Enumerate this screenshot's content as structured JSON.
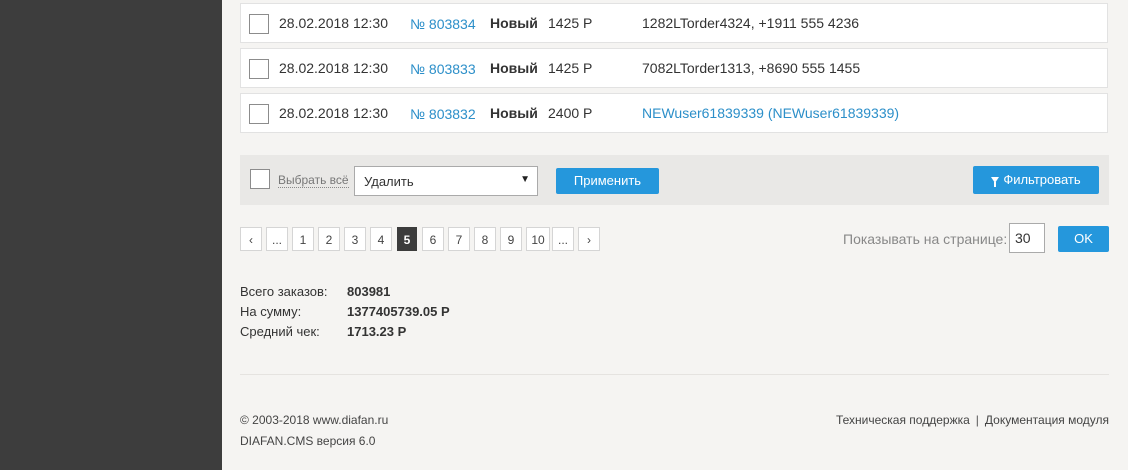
{
  "orders": [
    {
      "date": "28.02.2018 12:30",
      "number": "№ 803834",
      "status": "Новый",
      "amount": "1425 Р",
      "customer": "1282LTorder4324, +1911 555 4236"
    },
    {
      "date": "28.02.2018 12:30",
      "number": "№ 803833",
      "status": "Новый",
      "amount": "1425 Р",
      "customer": "7082LTorder1313, +8690 555 1455"
    },
    {
      "date": "28.02.2018 12:30",
      "number": "№ 803832",
      "status": "Новый",
      "amount": "2400 Р",
      "customer": "NEWuser61839339 (NEWuser61839339)"
    }
  ],
  "actions": {
    "select_all_label": "Выбрать всё",
    "selected_action": "Удалить",
    "select_arrow": "▼",
    "apply_label": "Применить",
    "filter_label": "Фильтровать"
  },
  "pagination": {
    "prev": "‹",
    "ellipsis_left": "...",
    "pages": [
      "1",
      "2",
      "3",
      "4",
      "5",
      "6",
      "7",
      "8",
      "9",
      "10"
    ],
    "current": "5",
    "ellipsis_right": "...",
    "next": "›",
    "per_page_label": "Показывать на странице:",
    "per_page_value": "30",
    "ok_label": "OK"
  },
  "totals": {
    "total_orders_label": "Всего заказов:",
    "total_orders_value": "803981",
    "sum_label": "На сумму:",
    "sum_value": "1377405739.05 Р",
    "average_label": "Средний чек:",
    "average_value": "1713.23 Р"
  },
  "footer": {
    "copyright": "© 2003-2018 www.diafan.ru",
    "version": "DIAFAN.CMS версия 6.0",
    "support_link": "Техническая поддержка",
    "separator": "|",
    "docs_link": "Документация модуля"
  },
  "colors": {
    "accent": "#2597dc",
    "link": "#2c8fc9",
    "sidebar": "#3d3d3d",
    "background": "#f5f4f2"
  }
}
